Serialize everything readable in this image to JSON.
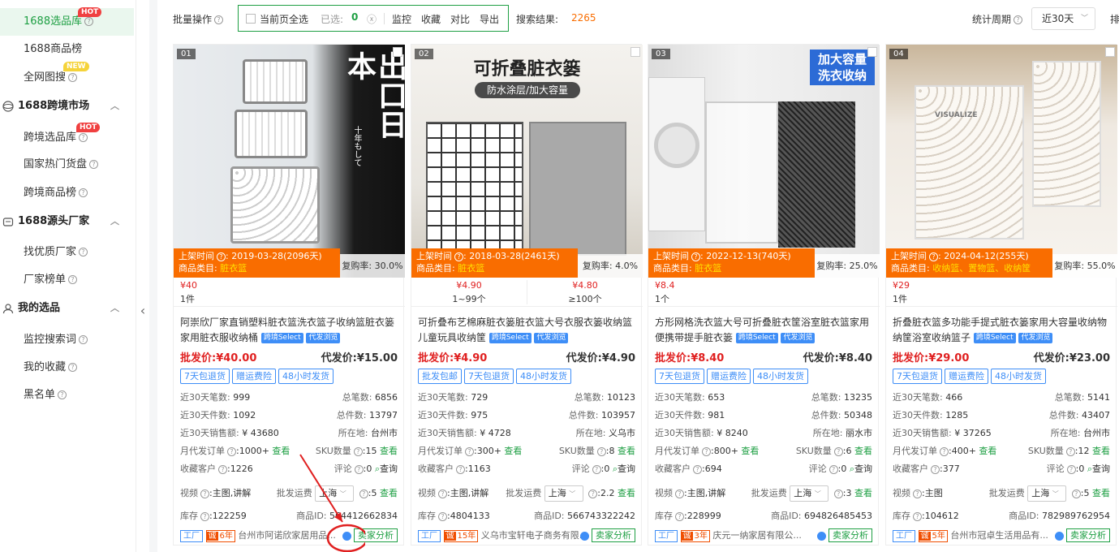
{
  "sidebar": {
    "items": [
      {
        "label": "1688选品库",
        "badge": "HOT",
        "active": true
      },
      {
        "label": "1688商品榜"
      },
      {
        "label": "全网图搜",
        "badge": "NEW"
      },
      {
        "label": "1688跨境市场",
        "section": true
      },
      {
        "label": "跨境选品库",
        "badge": "HOT"
      },
      {
        "label": "国家热门货盘"
      },
      {
        "label": "跨境商品榜"
      },
      {
        "label": "1688源头厂家",
        "section": true
      },
      {
        "label": "找优质厂家"
      },
      {
        "label": "厂家榜单"
      },
      {
        "label": "我的选品",
        "section": true
      },
      {
        "label": "监控搜索词"
      },
      {
        "label": "我的收藏"
      },
      {
        "label": "黑名单"
      }
    ]
  },
  "toolbar": {
    "batch_label": "批量操作",
    "select_all_label": "当前页全选",
    "selected_label": "已选:",
    "selected_count": "0",
    "actions": [
      "监控",
      "收藏",
      "对比",
      "导出"
    ],
    "results_label": "搜索结果:",
    "results_count": "2265",
    "period_label": "统计周期",
    "period_value": "近30天",
    "sort_label": "排"
  },
  "labels": {
    "listing_time": "上架时间",
    "category": "商品类目:",
    "repurchase": "复购率:",
    "wholesale": "批发价:",
    "dropship": "代发价:",
    "sales_30d": "近30天笔数:",
    "total_sales": "总笔数:",
    "pieces_30d": "近30天件数:",
    "total_pieces": "总件数:",
    "amount_30d": "近30天销售额:",
    "location": "所在地:",
    "monthly_orders": "月代发订单",
    "sku_count": "SKU数量",
    "view": "查看",
    "fav_customers": "收藏客户",
    "reviews": "评论",
    "query": "查询",
    "video": "视频",
    "ship_from": "批发运费",
    "stock": "库存",
    "product_id": "商品ID:",
    "factory": "工厂",
    "seller_analysis": "卖家分析",
    "tag_select": "跨境Select",
    "tag_browse": "代发浏览"
  },
  "products": [
    {
      "rank": "01",
      "listed": "2019-03-28(2096天)",
      "category": "脏衣篮",
      "repurchase": "30.0%",
      "tiers": [
        {
          "price": "¥40",
          "qty": "1件"
        }
      ],
      "title": "阿崇欣厂家直销塑料脏衣篮洗衣篮子收纳篮脏衣篓家用脏衣服收纳桶",
      "wholesale": "¥40.00",
      "dropship": "¥15.00",
      "tags": [
        "7天包退货",
        "赠运费险",
        "48小时发货"
      ],
      "sales_30d": "999",
      "total_sales": "6856",
      "pieces_30d": "1092",
      "total_pieces": "13797",
      "amount_30d": "¥ 43680",
      "location": "台州市",
      "monthly_orders": ":1000+",
      "sku": ":15",
      "fav": ":1226",
      "reviews": ":0",
      "video": ":主图,讲解",
      "ship_from": "上海",
      "ship_count": ":5",
      "stock": ":122259",
      "pid": "564412662834",
      "years": "6年",
      "company": "台州市阿诺欣家居用品..."
    },
    {
      "rank": "02",
      "listed": "2018-03-28(2461天)",
      "category": "脏衣篮",
      "repurchase": "4.0%",
      "tiers": [
        {
          "price": "¥4.90",
          "qty": "1~99个"
        },
        {
          "price": "¥4.80",
          "qty": "≥100个"
        }
      ],
      "title": "可折叠布艺棉麻脏衣篓脏衣篮大号衣服衣篓收纳篮儿童玩具收纳筐",
      "wholesale": "¥4.90",
      "dropship": "¥4.90",
      "tags": [
        "批发包邮",
        "7天包退货",
        "48小时发货"
      ],
      "sales_30d": "729",
      "total_sales": "10123",
      "pieces_30d": "975",
      "total_pieces": "103957",
      "amount_30d": "¥ 4728",
      "location": "义乌市",
      "monthly_orders": ":300+",
      "sku": ":8",
      "fav": ":1163",
      "reviews": ":0",
      "video": ":主图,讲解",
      "ship_from": "上海",
      "ship_count": ":2.2",
      "stock": ":4804133",
      "pid": "566743322242",
      "years": "15年",
      "company": "义乌市宝轩电子商务有限..."
    },
    {
      "rank": "03",
      "listed": "2022-12-13(740天)",
      "category": "脏衣篮",
      "repurchase": "25.0%",
      "tiers": [
        {
          "price": "¥8.4",
          "qty": "1个"
        }
      ],
      "title": "方形网格洗衣篮大号可折叠脏衣筐浴室脏衣篮家用便携带提手脏衣篓",
      "wholesale": "¥8.40",
      "dropship": "¥8.40",
      "tags": [
        "7天包退货",
        "赠运费险",
        "48小时发货"
      ],
      "sales_30d": "653",
      "total_sales": "13235",
      "pieces_30d": "981",
      "total_pieces": "50348",
      "amount_30d": "¥ 8240",
      "location": "丽水市",
      "monthly_orders": ":800+",
      "sku": ":6",
      "fav": ":694",
      "reviews": ":0",
      "video": ":主图,讲解",
      "ship_from": "上海",
      "ship_count": ":3",
      "stock": ":228999",
      "pid": "694826485453",
      "years": "3年",
      "company": "庆元一纳家居有限公..."
    },
    {
      "rank": "04",
      "listed": "2024-04-12(255天)",
      "category": "收纳篮、置物篮、收纳筐",
      "repurchase": "55.0%",
      "tiers": [
        {
          "price": "¥29",
          "qty": "1件"
        }
      ],
      "title": "折叠脏衣篮多功能手提式脏衣篓家用大容量收纳物纳筐浴室收纳篮子",
      "wholesale": "¥29.00",
      "dropship": "¥23.00",
      "tags": [
        "7天包退货",
        "赠运费险",
        "48小时发货"
      ],
      "sales_30d": "466",
      "total_sales": "5141",
      "pieces_30d": "1285",
      "total_pieces": "43407",
      "amount_30d": "¥ 37265",
      "location": "台州市",
      "monthly_orders": ":400+",
      "sku": ":12",
      "fav": ":377",
      "reviews": ":0",
      "video": ":主图",
      "ship_from": "上海",
      "ship_count": ":5",
      "stock": ":104612",
      "pid": "782989762954",
      "years": "5年",
      "company": "台州市冠卓生活用品有..."
    }
  ],
  "image_text": {
    "p1_big": "出口日本",
    "p1_small": "十年もして",
    "p2_headline": "可折叠脏衣篓",
    "p2_sub": "防水涂层/加大容量",
    "p3_line1": "加大容量",
    "p3_line2": "洗衣收纳",
    "p4_brand": "VISUALIZE"
  },
  "colors": {
    "accent": "#1e9f43",
    "price_red": "#e02020",
    "orange": "#f96d00",
    "tag_blue": "#3e8ef7",
    "annotation": "#e02020"
  }
}
